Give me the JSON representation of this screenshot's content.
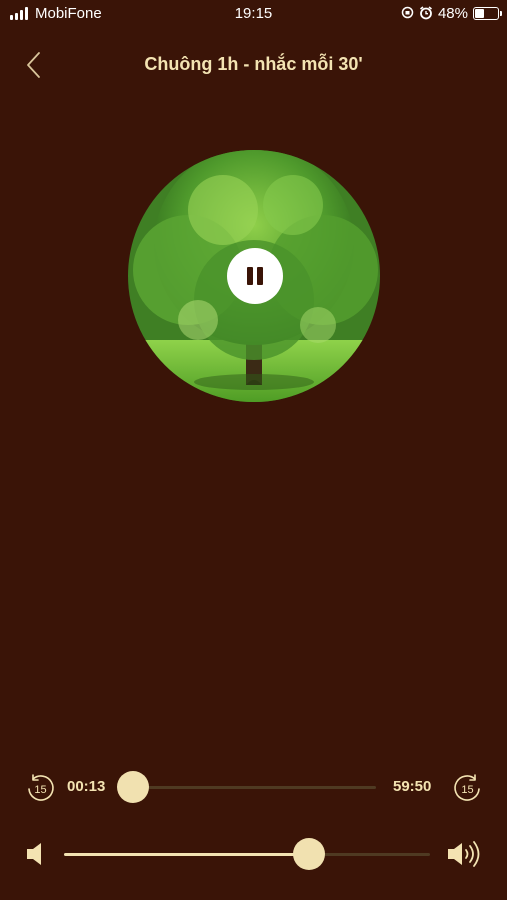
{
  "status_bar": {
    "carrier": "MobiFone",
    "time": "19:15",
    "battery": "48%"
  },
  "header": {
    "title": "Chuông 1h  - nhắc mỗi 30'"
  },
  "player": {
    "state_icon": "pause-icon",
    "artwork": "tree-in-meadow"
  },
  "progress": {
    "skip_back_label": "15",
    "skip_forward_label": "15",
    "elapsed": "00:13",
    "remaining": "59:50",
    "position_fraction": 0.004
  },
  "volume": {
    "level_fraction": 0.67
  },
  "colors": {
    "background": "#3a1407",
    "accent": "#f3e3b2",
    "track_inactive": "#4f3a22"
  }
}
